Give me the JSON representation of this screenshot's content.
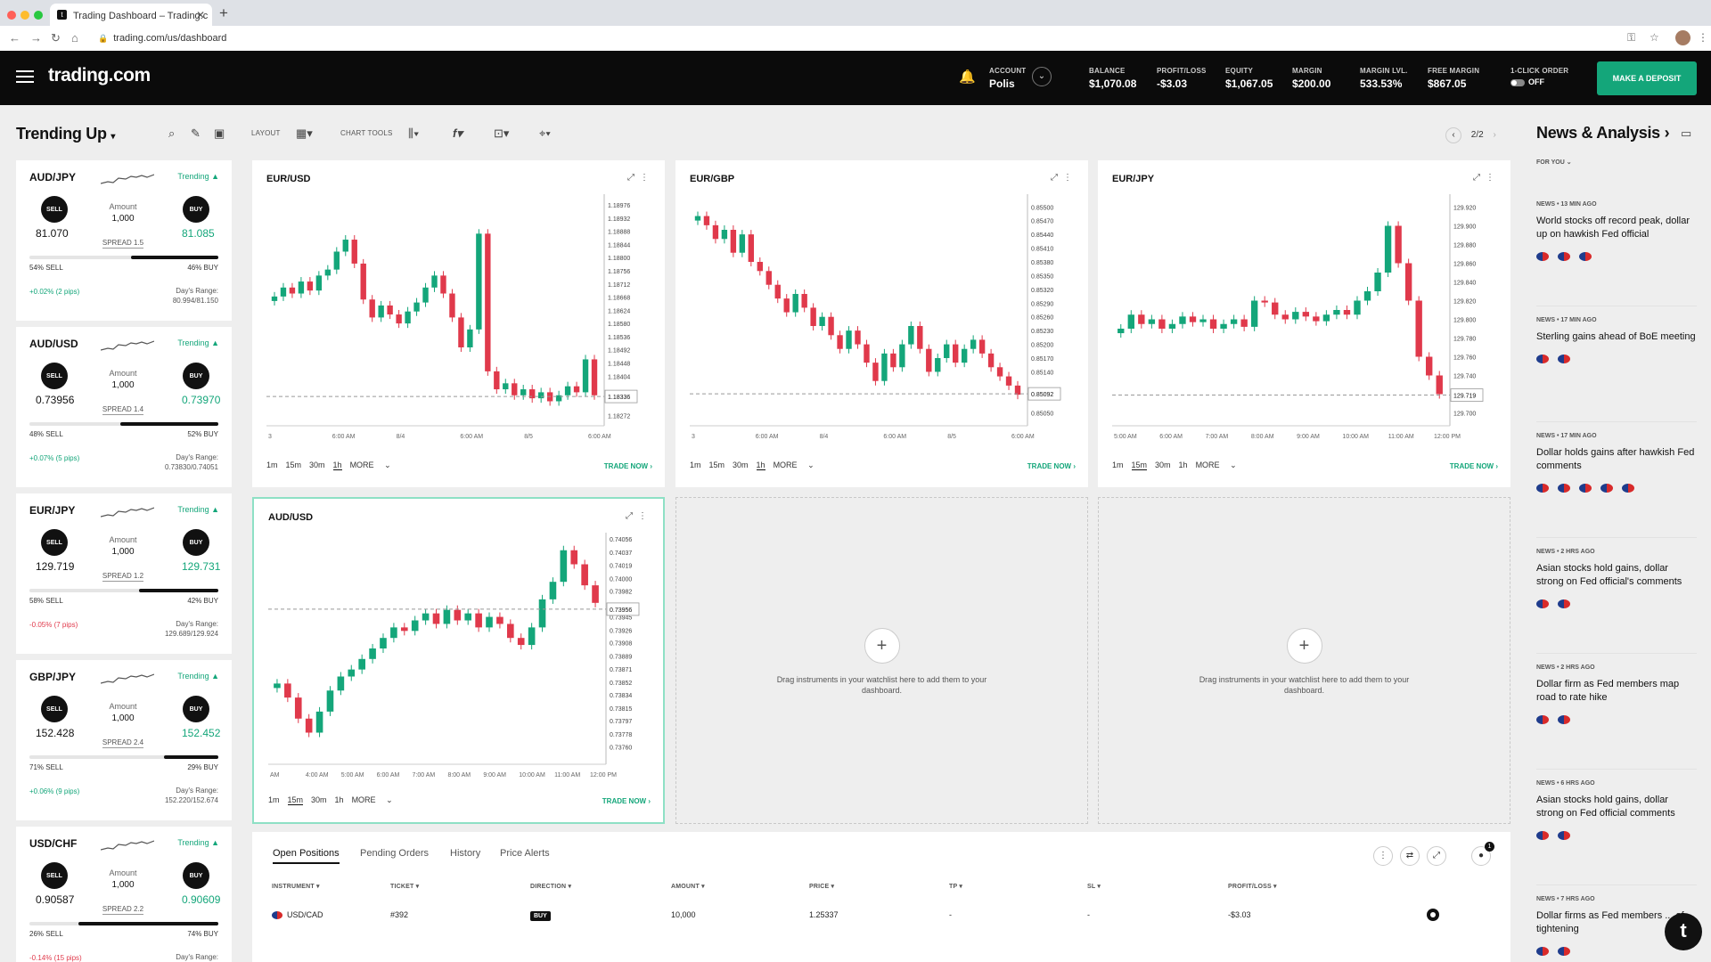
{
  "browser": {
    "tab_title": "Trading Dashboard – Trading.c",
    "favicon": "t",
    "url": "trading.com/us/dashboard"
  },
  "header": {
    "logo": "trading.com",
    "account_label": "ACCOUNT",
    "account_name": "Polis",
    "stats": [
      {
        "label": "BALANCE",
        "value": "$1,070.08"
      },
      {
        "label": "PROFIT/LOSS",
        "value": "-$3.03"
      },
      {
        "label": "EQUITY",
        "value": "$1,067.05"
      },
      {
        "label": "MARGIN",
        "value": "$200.00"
      },
      {
        "label": "MARGIN LVL.",
        "value": "533.53%"
      },
      {
        "label": "FREE MARGIN",
        "value": "$867.05"
      }
    ],
    "one_click_label": "1-CLICK ORDER",
    "one_click_value": "OFF",
    "deposit_label": "MAKE A DEPOSIT"
  },
  "toolbar": {
    "title": "Trending Up",
    "layout_label": "LAYOUT",
    "chart_tools_label": "CHART TOOLS",
    "page": "2/2",
    "news_title": "News & Analysis"
  },
  "watchlist": [
    {
      "symbol": "AUD/JPY",
      "trend": "Trending",
      "sell_label": "SELL",
      "buy_label": "BUY",
      "sell": "81.070",
      "buy": "81.085",
      "amount_label": "Amount",
      "amount": "1,000",
      "spread": "SPREAD 1.5",
      "sell_pct": "54% SELL",
      "buy_pct": "46% BUY",
      "buy_frac": 0.46,
      "change": "+0.02% (2 pips)",
      "range_label": "Day's Range:",
      "range": "80.994/81.150"
    },
    {
      "symbol": "AUD/USD",
      "trend": "Trending",
      "sell_label": "SELL",
      "buy_label": "BUY",
      "sell": "0.73956",
      "buy": "0.73970",
      "amount_label": "Amount",
      "amount": "1,000",
      "spread": "SPREAD 1.4",
      "sell_pct": "48% SELL",
      "buy_pct": "52% BUY",
      "buy_frac": 0.52,
      "change": "+0.07% (5 pips)",
      "range_label": "Day's Range:",
      "range": "0.73830/0.74051"
    },
    {
      "symbol": "EUR/JPY",
      "trend": "Trending",
      "sell_label": "SELL",
      "buy_label": "BUY",
      "sell": "129.719",
      "buy": "129.731",
      "amount_label": "Amount",
      "amount": "1,000",
      "spread": "SPREAD 1.2",
      "sell_pct": "58% SELL",
      "buy_pct": "42% BUY",
      "buy_frac": 0.42,
      "change": "-0.05% (7 pips)",
      "range_label": "Day's Range:",
      "range": "129.689/129.924"
    },
    {
      "symbol": "GBP/JPY",
      "trend": "Trending",
      "sell_label": "SELL",
      "buy_label": "BUY",
      "sell": "152.428",
      "buy": "152.452",
      "amount_label": "Amount",
      "amount": "1,000",
      "spread": "SPREAD 2.4",
      "sell_pct": "71% SELL",
      "buy_pct": "29% BUY",
      "buy_frac": 0.29,
      "change": "+0.06% (9 pips)",
      "range_label": "Day's Range:",
      "range": "152.220/152.674"
    },
    {
      "symbol": "USD/CHF",
      "trend": "Trending",
      "sell_label": "SELL",
      "buy_label": "BUY",
      "sell": "0.90587",
      "buy": "0.90609",
      "amount_label": "Amount",
      "amount": "1,000",
      "spread": "SPREAD 2.2",
      "sell_pct": "26% SELL",
      "buy_pct": "74% BUY",
      "buy_frac": 0.74,
      "change": "-0.14% (15 pips)",
      "range_label": "Day's Range:",
      "range": ""
    }
  ],
  "chart_common": {
    "timeframes": [
      "1m",
      "15m",
      "30m",
      "1h"
    ],
    "more_label": "MORE",
    "trade_label": "TRADE NOW",
    "empty_text": "Drag instruments in your watchlist here to add them to your dashboard."
  },
  "chart_data": [
    {
      "type": "candlestick",
      "title": "EUR/USD",
      "timeframe": "1h",
      "yticks": [
        "1.18976",
        "1.18932",
        "1.18888",
        "1.18844",
        "1.18800",
        "1.18756",
        "1.18712",
        "1.18668",
        "1.18624",
        "1.18580",
        "1.18536",
        "1.18492",
        "1.18448",
        "1.18404",
        "1.18336",
        "1.18272"
      ],
      "xticks": [
        "3",
        "6:00 AM",
        "8/4",
        "6:00 AM",
        "8/5",
        "6:00 AM"
      ],
      "current_price": "1.18336",
      "ylim": [
        1.1825,
        1.19
      ],
      "closes": [
        1.1867,
        1.187,
        1.1868,
        1.1872,
        1.1869,
        1.1874,
        1.1876,
        1.1882,
        1.1886,
        1.1878,
        1.1866,
        1.186,
        1.1864,
        1.1861,
        1.1858,
        1.1862,
        1.1865,
        1.187,
        1.1874,
        1.1868,
        1.186,
        1.185,
        1.1856,
        1.1888,
        1.1842,
        1.1836,
        1.1838,
        1.1834,
        1.1836,
        1.1833,
        1.1835,
        1.1832,
        1.1834,
        1.1837,
        1.1835,
        1.1846,
        1.1834
      ]
    },
    {
      "type": "candlestick",
      "title": "EUR/GBP",
      "timeframe": "1h",
      "yticks": [
        "0.85500",
        "0.85470",
        "0.85440",
        "0.85410",
        "0.85380",
        "0.85350",
        "0.85320",
        "0.85290",
        "0.85260",
        "0.85230",
        "0.85200",
        "0.85170",
        "0.85140",
        "0.85092",
        "0.85050"
      ],
      "xticks": [
        "3",
        "6:00 AM",
        "8/4",
        "6:00 AM",
        "8/5",
        "6:00 AM"
      ],
      "current_price": "0.85092",
      "ylim": [
        0.8503,
        0.8552
      ],
      "closes": [
        0.8548,
        0.8546,
        0.8543,
        0.8545,
        0.854,
        0.8544,
        0.8538,
        0.8536,
        0.8533,
        0.853,
        0.8527,
        0.8531,
        0.8528,
        0.8524,
        0.8526,
        0.8522,
        0.8519,
        0.8523,
        0.852,
        0.8516,
        0.8512,
        0.8518,
        0.8515,
        0.852,
        0.8524,
        0.8519,
        0.8514,
        0.8517,
        0.852,
        0.8516,
        0.8519,
        0.8521,
        0.8518,
        0.8515,
        0.8513,
        0.8511,
        0.8509
      ]
    },
    {
      "type": "candlestick",
      "title": "EUR/JPY",
      "timeframe": "15m",
      "yticks": [
        "129.920",
        "129.900",
        "129.880",
        "129.860",
        "129.840",
        "129.820",
        "129.800",
        "129.780",
        "129.760",
        "129.740",
        "129.719",
        "129.700"
      ],
      "xticks": [
        "5:00 AM",
        "6:00 AM",
        "7:00 AM",
        "8:00 AM",
        "9:00 AM",
        "10:00 AM",
        "11:00 AM",
        "12:00 PM"
      ],
      "current_price": "129.719",
      "ylim": [
        129.69,
        129.93
      ],
      "closes": [
        129.79,
        129.805,
        129.795,
        129.8,
        129.79,
        129.795,
        129.803,
        129.797,
        129.8,
        129.79,
        129.795,
        129.8,
        129.792,
        129.82,
        129.818,
        129.805,
        129.8,
        129.808,
        129.803,
        129.798,
        129.805,
        129.81,
        129.805,
        129.82,
        129.83,
        129.85,
        129.9,
        129.86,
        129.82,
        129.76,
        129.74,
        129.72
      ]
    },
    {
      "type": "candlestick",
      "title": "AUD/USD",
      "timeframe": "15m",
      "yticks": [
        "0.74056",
        "0.74037",
        "0.74019",
        "0.74000",
        "0.73982",
        "0.73956",
        "0.73945",
        "0.73926",
        "0.73908",
        "0.73889",
        "0.73871",
        "0.73852",
        "0.73834",
        "0.73815",
        "0.73797",
        "0.73778",
        "0.73760"
      ],
      "xticks": [
        "AM",
        "4:00 AM",
        "5:00 AM",
        "6:00 AM",
        "7:00 AM",
        "8:00 AM",
        "9:00 AM",
        "10:00 AM",
        "11:00 AM",
        "12:00 PM"
      ],
      "current_price": "0.73956",
      "ylim": [
        0.7374,
        0.7406
      ],
      "closes": [
        0.7385,
        0.7383,
        0.738,
        0.7378,
        0.7381,
        0.7384,
        0.7386,
        0.7387,
        0.73885,
        0.739,
        0.73915,
        0.7393,
        0.73925,
        0.7394,
        0.7395,
        0.73935,
        0.73955,
        0.7394,
        0.7395,
        0.7393,
        0.73945,
        0.73935,
        0.73915,
        0.73905,
        0.7393,
        0.7397,
        0.73995,
        0.7404,
        0.7402,
        0.7399,
        0.73965
      ]
    }
  ],
  "positions": {
    "tabs": [
      "Open Positions",
      "Pending Orders",
      "History",
      "Price Alerts"
    ],
    "columns": [
      "INSTRUMENT",
      "TICKET",
      "DIRECTION",
      "AMOUNT",
      "PRICE",
      "TP",
      "SL",
      "PROFIT/LOSS"
    ],
    "rows": [
      {
        "instrument": "USD/CAD",
        "ticket": "#392",
        "direction": "BUY",
        "amount": "10,000",
        "price": "1.25337",
        "tp": "-",
        "sl": "-",
        "pl": "-$3.03"
      }
    ],
    "notif_count": "1"
  },
  "news": {
    "filter": "FOR YOU",
    "items": [
      {
        "meta": "NEWS • 13 MIN AGO",
        "headline": "World stocks off record peak, dollar up on hawkish Fed official",
        "flags": 3
      },
      {
        "meta": "NEWS • 17 MIN AGO",
        "headline": "Sterling gains ahead of BoE meeting",
        "flags": 2
      },
      {
        "meta": "NEWS • 17 MIN AGO",
        "headline": "Dollar holds gains after hawkish Fed comments",
        "flags": 5
      },
      {
        "meta": "NEWS • 2 HRS AGO",
        "headline": "Asian stocks hold gains, dollar strong on Fed official's comments",
        "flags": 2
      },
      {
        "meta": "NEWS • 2 HRS AGO",
        "headline": "Dollar firm as Fed members map road to rate hike",
        "flags": 2
      },
      {
        "meta": "NEWS • 6 HRS AGO",
        "headline": "Asian stocks hold gains, dollar strong on Fed official comments",
        "flags": 2
      },
      {
        "meta": "NEWS • 7 HRS AGO",
        "headline": "Dollar firms as Fed members ... of tightening",
        "flags": 2
      }
    ]
  },
  "colors": {
    "accent": "#14a67a",
    "down": "#e0394b",
    "up": "#14a67a"
  }
}
